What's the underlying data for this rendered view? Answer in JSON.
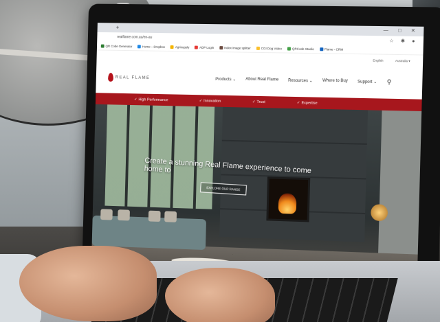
{
  "browser": {
    "new_tab": "+",
    "url": "realflame.com.au/en-au",
    "window_controls": "—  □  ✕",
    "bookmarks": [
      {
        "label": "QR Code Generator",
        "color": "#2e7d32"
      },
      {
        "label": "Home – Dropbox",
        "color": "#1e88e5"
      },
      {
        "label": "Agrisupply",
        "color": "#f4b400"
      },
      {
        "label": "ADP Login",
        "color": "#e53935"
      },
      {
        "label": "Index image splitter",
        "color": "#6d4c41"
      },
      {
        "label": "CGI Dog Video",
        "color": "#fbc02d"
      },
      {
        "label": "QRCode Studio",
        "color": "#43a047"
      },
      {
        "label": "Flame - CRM",
        "color": "#1565c0"
      }
    ]
  },
  "site": {
    "lang": "English",
    "country": "Australia",
    "logo_text": "REAL FLAME",
    "nav": {
      "products": "Products",
      "about": "About Real Flame",
      "resources": "Resources",
      "where_to_buy": "Where to Buy",
      "support": "Support"
    },
    "values_bar": [
      "High Performance",
      "Innovation",
      "Trust",
      "Expertise"
    ],
    "hero": {
      "heading": "Create a stunning Real Flame experience to come home to",
      "button": "EXPLORE OUR RANGE"
    }
  },
  "colors": {
    "brand_red": "#a7171d"
  }
}
